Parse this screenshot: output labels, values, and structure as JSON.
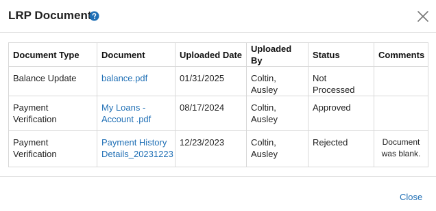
{
  "dialog": {
    "title": "LRP Documents",
    "close_link": "Close"
  },
  "icons": {
    "help": "help-circle-icon",
    "close": "close-icon"
  },
  "colors": {
    "link": "#1f6fb5",
    "help_icon": "#1f6fb5"
  },
  "table": {
    "headers": [
      "Document Type",
      "Document",
      "Uploaded Date",
      "Uploaded By",
      "Status",
      "Comments"
    ],
    "rows": [
      {
        "type": "Balance Update",
        "document": [
          "balance.pdf"
        ],
        "date": "01/31/2025",
        "by": "Coltin, Ausley",
        "status": "Not Processed",
        "comments": [
          "",
          ""
        ]
      },
      {
        "type": "Payment Verification",
        "document": [
          "My Loans -",
          "Account .pdf"
        ],
        "date": "08/17/2024",
        "by": "Coltin, Ausley",
        "status": "Approved",
        "comments": [
          "",
          ""
        ]
      },
      {
        "type": "Payment Verification",
        "document": [
          "Payment History",
          "Details_20231223"
        ],
        "date": "12/23/2023",
        "by": "Coltin, Ausley",
        "status": "Rejected",
        "comments": [
          "Document",
          "was blank."
        ]
      }
    ]
  }
}
